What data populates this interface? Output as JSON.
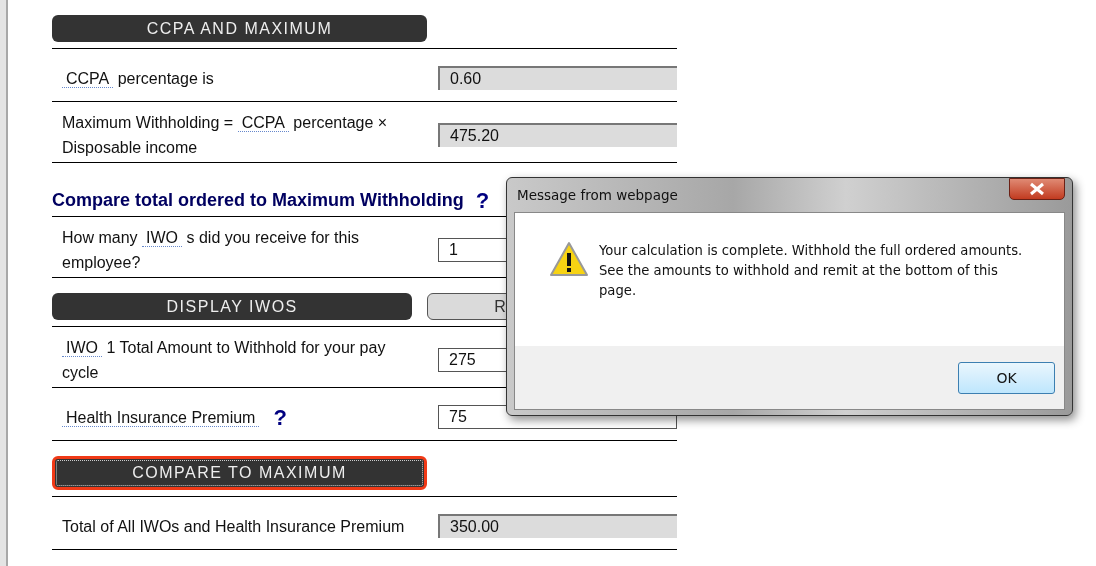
{
  "sections": [
    {
      "kind": "button",
      "label": "CCPA AND MAXIMUM",
      "focused": false
    },
    {
      "kind": "field",
      "label": [
        {
          "text": "CCPA",
          "abbr": true
        },
        {
          "text": " percentage is"
        }
      ],
      "value": "0.60",
      "readonly": true
    },
    {
      "kind": "field",
      "label": [
        {
          "text": "Maximum Withholding = "
        },
        {
          "text": "CCPA",
          "abbr": true
        },
        {
          "text": " percentage × Disposable income"
        }
      ],
      "value": "475.20",
      "readonly": true
    },
    {
      "kind": "heading",
      "label": "Compare total ordered to Maximum Withholding",
      "help": "?"
    },
    {
      "kind": "field",
      "label": [
        {
          "text": "How many "
        },
        {
          "text": "IWO",
          "abbr": true
        },
        {
          "text": " s did you receive for this employee?"
        }
      ],
      "value": "1",
      "readonly": false
    },
    {
      "kind": "buttons",
      "buttons": [
        {
          "label": "DISPLAY IWOS"
        },
        {
          "label": "R"
        }
      ]
    },
    {
      "kind": "field",
      "label": [
        {
          "text": "IWO",
          "abbr": true
        },
        {
          "text": " 1 Total Amount to Withhold for your pay cycle"
        }
      ],
      "value": "275",
      "readonly": false
    },
    {
      "kind": "field",
      "label": [
        {
          "text": "Health Insurance Premium",
          "abbr": true
        }
      ],
      "help": "?",
      "value": "75",
      "readonly": false
    },
    {
      "kind": "button",
      "label": "COMPARE TO MAXIMUM",
      "focused": true
    },
    {
      "kind": "field",
      "label": [
        {
          "text": "Total of All IWOs and Health Insurance Premium"
        }
      ],
      "value": "350.00",
      "readonly": true
    }
  ],
  "dialog": {
    "title": "Message from webpage",
    "message": "Your calculation is complete. Withhold the full ordered amounts. See the amounts to withhold and remit at the bottom of this page.",
    "button": "OK"
  }
}
